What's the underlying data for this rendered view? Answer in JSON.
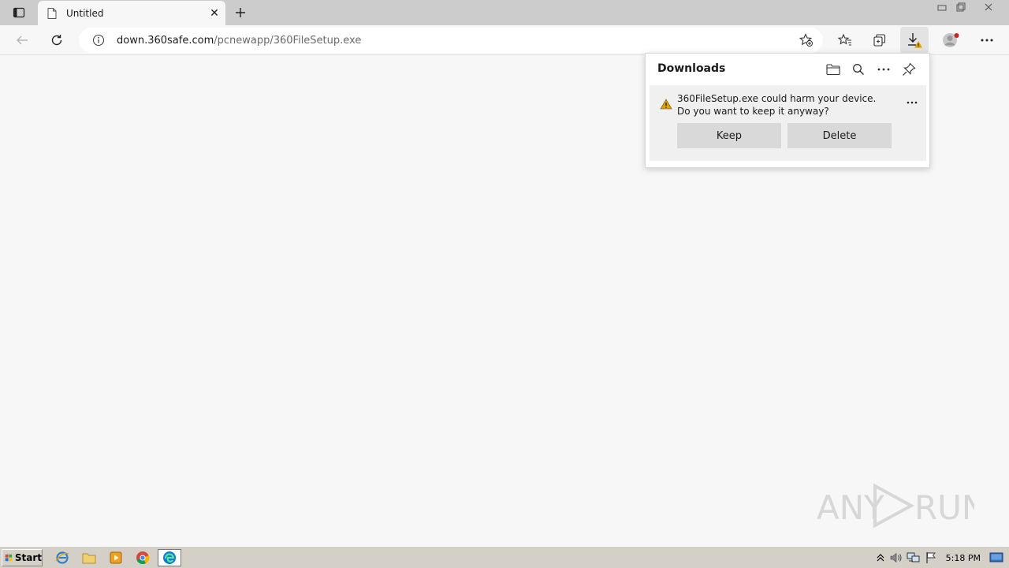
{
  "window": {
    "tab_title": "Untitled",
    "controls": [
      "minimize",
      "restore",
      "close"
    ]
  },
  "toolbar": {
    "url_host": "down.360safe.com",
    "url_path": "/pcnewapp/360FileSetup.exe"
  },
  "downloads": {
    "title": "Downloads",
    "item": {
      "message": "360FileSetup.exe could harm your device. Do you want to keep it anyway?",
      "keep_label": "Keep",
      "delete_label": "Delete"
    }
  },
  "watermark": {
    "text": "ANY RUN"
  },
  "taskbar": {
    "start_label": "Start",
    "clock": "5:18 PM"
  },
  "colors": {
    "warning": "#e0a000",
    "tab_bar": "#cccccc",
    "button": "#d9d9d9"
  }
}
